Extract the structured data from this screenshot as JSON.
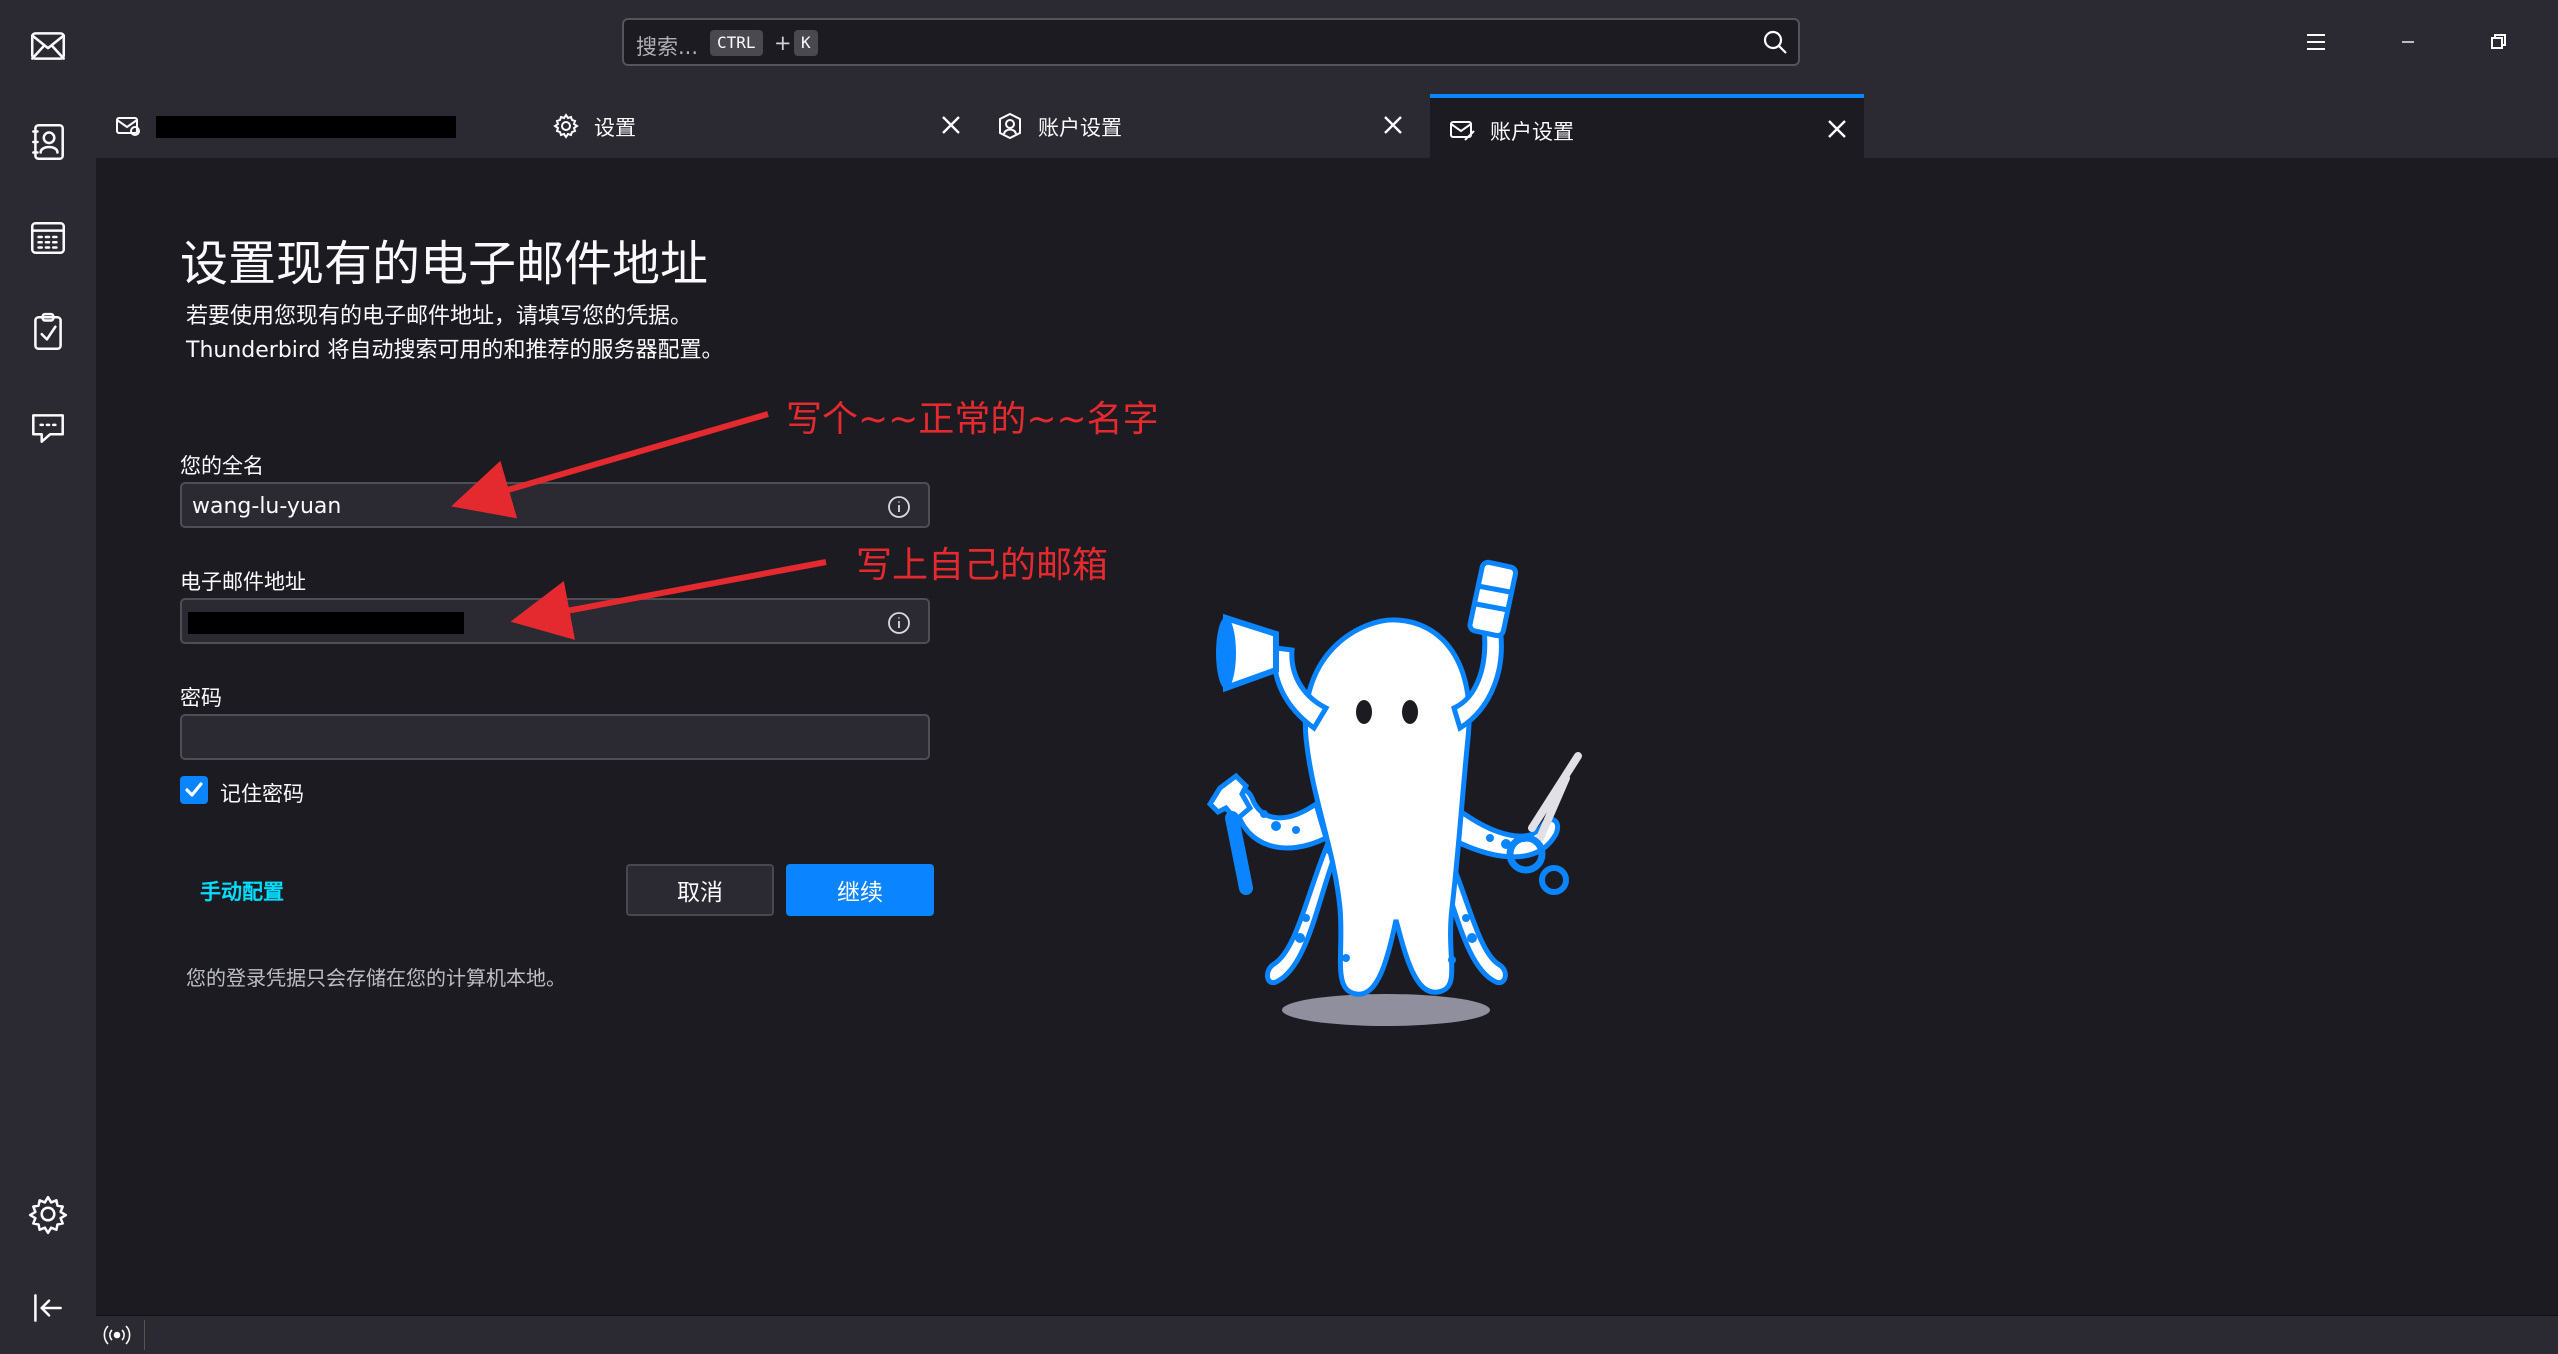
{
  "search": {
    "placeholder": "搜索...",
    "key1": "CTRL",
    "plus": "+",
    "key2": "K"
  },
  "spaces": {
    "items": [
      "mail-icon",
      "address-book-icon",
      "calendar-icon",
      "tasks-icon",
      "chat-icon"
    ],
    "settings": "gear-icon",
    "collapse": "collapse-icon"
  },
  "tabs": [
    {
      "label": "",
      "icon": "mail-account-icon",
      "redacted": true
    },
    {
      "label": "设置",
      "icon": "gear-icon"
    },
    {
      "label": "账户设置",
      "icon": "account-icon"
    },
    {
      "label": "账户设置",
      "icon": "mail-edit-icon",
      "active": true
    }
  ],
  "form": {
    "title": "设置现有的电子邮件地址",
    "intro_line1": "若要使用您现有的电子邮件地址，请填写您的凭据。",
    "intro_line2": "Thunderbird 将自动搜索可用的和推荐的服务器配置。",
    "name_label": "您的全名",
    "name_value": "wang-lu-yuan",
    "email_label": "电子邮件地址",
    "email_value": "",
    "password_label": "密码",
    "password_value": "",
    "remember_label": "记住密码",
    "remember_checked": true,
    "manual_link": "手动配置",
    "cancel": "取消",
    "continue": "继续",
    "note": "您的登录凭据只会存储在您的计算机本地。"
  },
  "annotations": {
    "name_hint": "写个~~正常的~~名字",
    "email_hint": "写上自己的邮箱"
  },
  "colors": {
    "accent": "#0a84ff",
    "link": "#00ddff",
    "annotation": "#e52a2f",
    "background": "#1c1b22",
    "panel": "#2b2a33"
  }
}
